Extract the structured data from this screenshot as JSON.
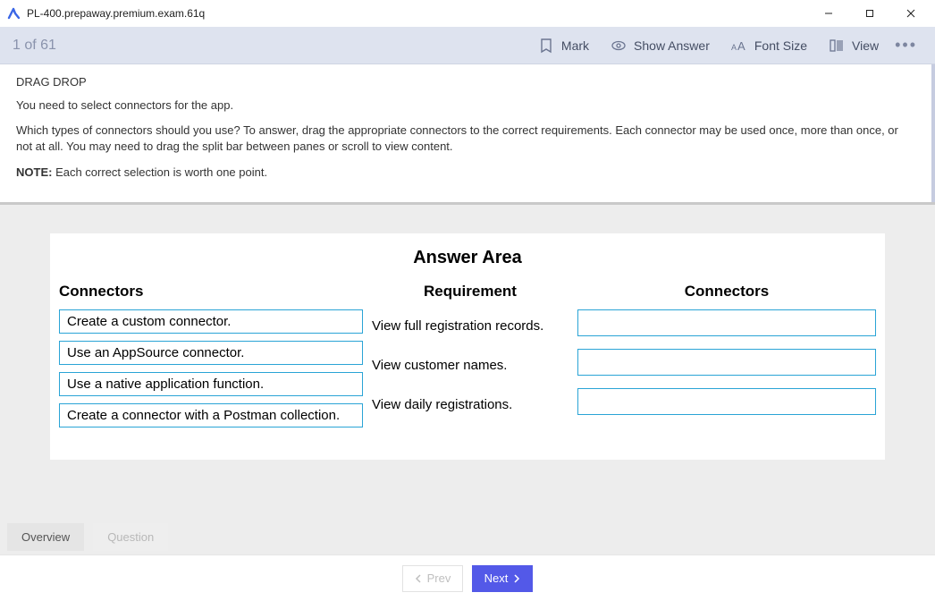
{
  "window": {
    "title": "PL-400.prepaway.premium.exam.61q"
  },
  "toolbar": {
    "counter": "1 of 61",
    "mark": "Mark",
    "show_answer": "Show Answer",
    "font_size": "Font Size",
    "view": "View"
  },
  "question": {
    "type": "DRAG DROP",
    "p1": "You need to select connectors for the app.",
    "p2": "Which types of connectors should you use? To answer, drag the appropriate connectors to the correct requirements. Each connector may be used once, more than once, or not at all. You may need to drag the split bar between panes or scroll to view content.",
    "note_label": "NOTE:",
    "note_text": " Each correct selection is worth one point."
  },
  "answer": {
    "title": "Answer Area",
    "headers": {
      "left": "Connectors",
      "mid": "Requirement",
      "right": "Connectors"
    },
    "connectors": [
      "Create a custom connector.",
      "Use an AppSource connector.",
      "Use a native application function.",
      "Create a connector with a Postman collection."
    ],
    "requirements": [
      "View full registration records.",
      "View customer names.",
      "View daily registrations."
    ]
  },
  "tabs": {
    "overview": "Overview",
    "question": "Question"
  },
  "footer": {
    "prev": "Prev",
    "next": "Next"
  }
}
